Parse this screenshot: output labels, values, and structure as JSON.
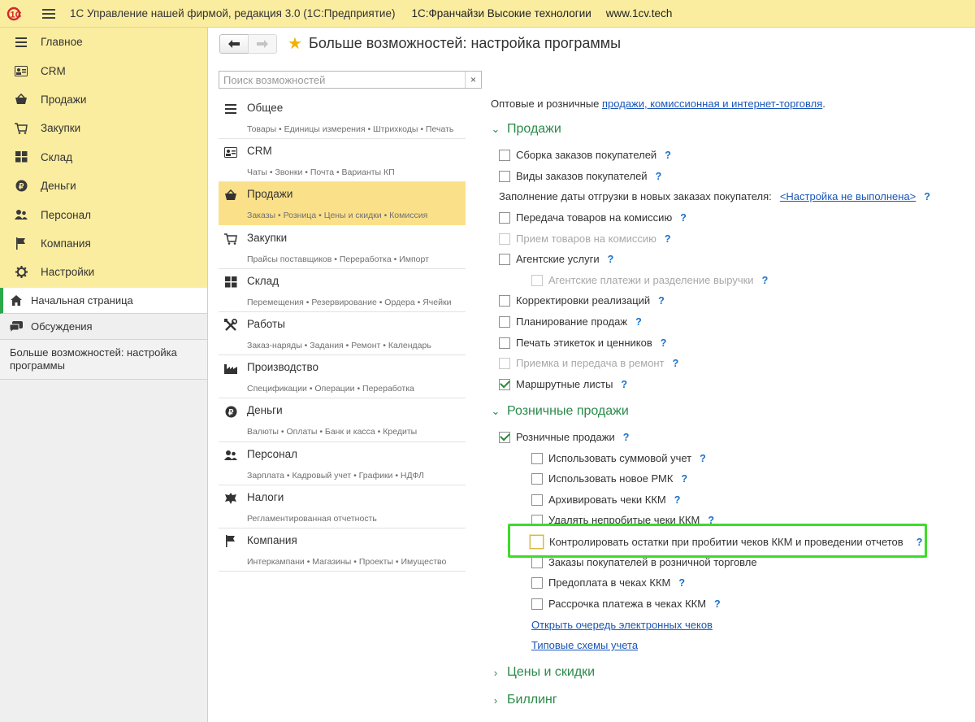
{
  "titlebar": {
    "logo": "1С",
    "title": "1С Управление нашей фирмой, редакция 3.0  (1С:Предприятие)",
    "franchise": "1С:Франчайзи Высокие технологии",
    "site": "www.1cv.tech"
  },
  "sidebar": {
    "sections": [
      {
        "label": "Главное",
        "icon": "menu-lines-icon"
      },
      {
        "label": "CRM",
        "icon": "contact-card-icon"
      },
      {
        "label": "Продажи",
        "icon": "basket-icon"
      },
      {
        "label": "Закупки",
        "icon": "cart-icon"
      },
      {
        "label": "Склад",
        "icon": "warehouse-icon"
      },
      {
        "label": "Деньги",
        "icon": "ruble-coin-icon"
      },
      {
        "label": "Персонал",
        "icon": "people-icon"
      },
      {
        "label": "Компания",
        "icon": "flag-icon"
      },
      {
        "label": "Настройки",
        "icon": "gear-icon"
      }
    ],
    "open_items": [
      {
        "label": "Начальная страница",
        "icon": "home-icon"
      },
      {
        "label": "Обсуждения",
        "icon": "chat-icon"
      }
    ],
    "open_form": "Больше возможностей: настройка программы"
  },
  "header": {
    "title": "Больше возможностей: настройка программы"
  },
  "search": {
    "placeholder": "Поиск возможностей",
    "value": "",
    "clear": "×"
  },
  "categories": [
    {
      "name": "Общее",
      "sub": "Товары • Единицы измерения • Штрихкоды • Печать",
      "icon": "menu-lines-icon"
    },
    {
      "name": "CRM",
      "sub": "Чаты • Звонки • Почта • Варианты КП",
      "icon": "contact-card-icon"
    },
    {
      "name": "Продажи",
      "sub": "Заказы • Розница • Цены и скидки • Комиссия",
      "icon": "basket-icon"
    },
    {
      "name": "Закупки",
      "sub": "Прайсы поставщиков • Переработка • Импорт",
      "icon": "cart-icon"
    },
    {
      "name": "Склад",
      "sub": "Перемещения • Резервирование • Ордера • Ячейки",
      "icon": "warehouse-icon"
    },
    {
      "name": "Работы",
      "sub": "Заказ-наряды • Задания • Ремонт • Календарь",
      "icon": "tools-icon"
    },
    {
      "name": "Производство",
      "sub": "Спецификации • Операции • Переработка",
      "icon": "factory-icon"
    },
    {
      "name": "Деньги",
      "sub": "Валюты • Оплаты • Банк и касса • Кредиты",
      "icon": "ruble-coin-icon"
    },
    {
      "name": "Персонал",
      "sub": "Зарплата • Кадровый учет • Графики • НДФЛ",
      "icon": "people-icon"
    },
    {
      "name": "Налоги",
      "sub": "Регламентированная отчетность",
      "icon": "eagle-emblem-icon"
    },
    {
      "name": "Компания",
      "sub": "Интеркампани • Магазины • Проекты • Имущество",
      "icon": "flag-icon"
    }
  ],
  "right": {
    "intro_prefix": "Оптовые и розничные ",
    "intro_link": "продажи, комиссионная и интернет-торговля",
    "intro_suffix": ".",
    "help": "?",
    "group_sales": "Продажи",
    "sales": {
      "assembly": "Сборка заказов покупателей",
      "order_kinds": "Виды заказов покупателей",
      "ship_date_label": "Заполнение даты отгрузки в новых заказах покупателя:",
      "ship_date_link": "<Настройка не выполнена>",
      "commission_out": "Передача товаров на комиссию",
      "commission_in": "Прием товаров на комиссию",
      "agent_services": "Агентские услуги",
      "agent_payments": "Агентские платежи и разделение выручки",
      "adjustments": "Корректировки реализаций",
      "planning": "Планирование продаж",
      "labels": "Печать этикеток и ценников",
      "repair": "Приемка и передача в ремонт",
      "routes": "Маршрутные листы"
    },
    "group_retail": "Розничные продажи",
    "retail": {
      "retail_sales": "Розничные продажи",
      "sum_accounting": "Использовать суммовой учет",
      "new_rmk": "Использовать новое РМК",
      "archive": "Архивировать чеки ККМ",
      "delete_unpunched": "Удалять непробитые чеки ККМ",
      "control_stock": "Контролировать остатки при пробитии чеков ККМ и проведении отчетов",
      "orders_retail": "Заказы покупателей в розничной торговле",
      "prepay": "Предоплата в чеках ККМ",
      "installment": "Рассрочка платежа в чеках ККМ",
      "queue_link": "Открыть очередь электронных чеков",
      "schemes_link": "Типовые схемы учета"
    },
    "group_prices": "Цены и скидки",
    "group_billing": "Биллинг"
  },
  "colors": {
    "accent_yellow": "#fbeda0",
    "selected_yellow": "#fbe08a",
    "group_green": "#2a8a4a",
    "link_blue": "#1a56b8",
    "highlight_green": "#3ddc2a"
  }
}
